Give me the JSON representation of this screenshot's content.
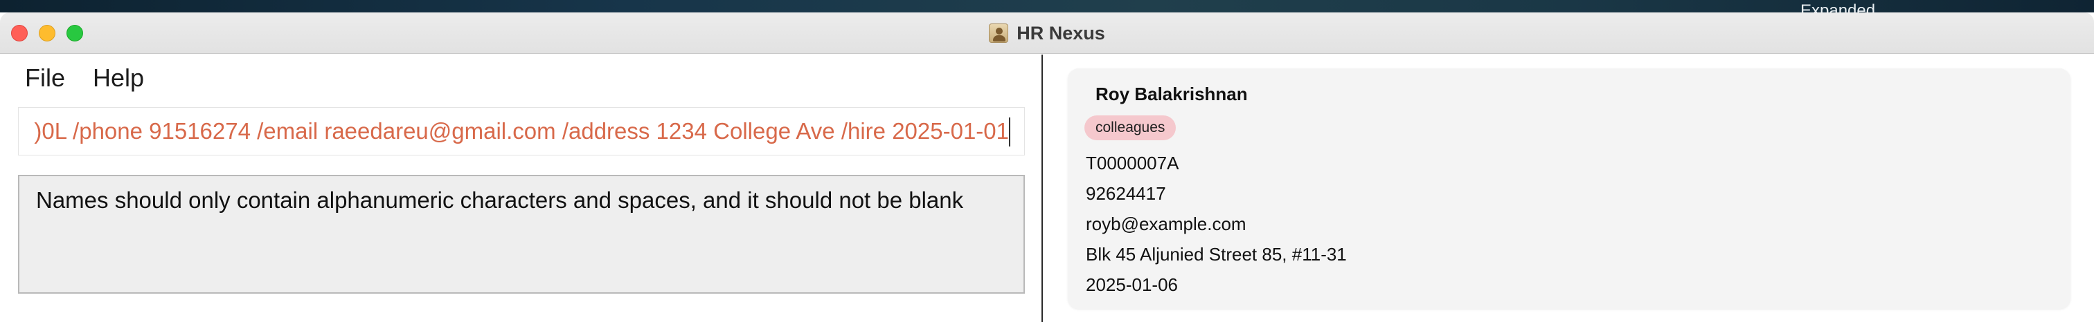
{
  "desktop": {
    "label": "Expanded"
  },
  "window": {
    "title": "HR Nexus",
    "app_icon": "person-icon"
  },
  "menu": {
    "file": "File",
    "help": "Help"
  },
  "command": {
    "value": ")0L /phone 91516274  /email raeedareu@gmail.com /address 1234 College Ave /hire 2025-01-01",
    "text_color": "#d8694a"
  },
  "result": {
    "message": "Names should only contain alphanumeric characters and spaces, and it should not be blank"
  },
  "person": {
    "name": "Roy Balakrishnan",
    "tag": "colleagues",
    "tag_color": "#f5c8cd",
    "nric": "T0000007A",
    "phone": "92624417",
    "email": "royb@example.com",
    "address": "Blk 45 Aljunied Street 85, #11-31",
    "hire_date": "2025-01-06"
  }
}
